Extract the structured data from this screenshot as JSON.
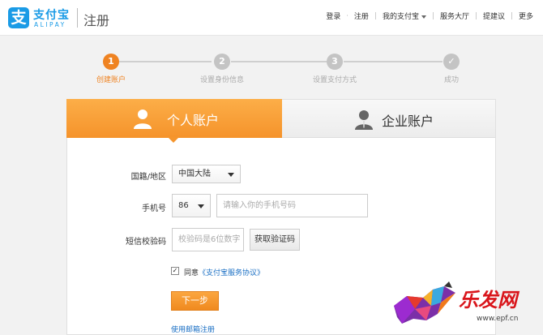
{
  "header": {
    "logo_mark": "支",
    "logo_cn": "支付宝",
    "logo_en": "ALIPAY",
    "page_title": "注册",
    "nav": {
      "login": "登录",
      "register": "注册",
      "my_alipay": "我的支付宝",
      "service_hall": "服务大厅",
      "feedback": "提建议",
      "more": "更多"
    }
  },
  "steps": [
    {
      "num": "1",
      "label": "创建账户"
    },
    {
      "num": "2",
      "label": "设置身份信息"
    },
    {
      "num": "3",
      "label": "设置支付方式"
    },
    {
      "num": "✓",
      "label": "成功"
    }
  ],
  "tabs": {
    "personal": "个人账户",
    "business": "企业账户"
  },
  "form": {
    "region_label": "国籍/地区",
    "region_value": "中国大陆",
    "phone_label": "手机号",
    "phone_code": "86",
    "phone_placeholder": "请输入你的手机号码",
    "sms_label": "短信校验码",
    "sms_placeholder": "校验码是6位数字",
    "get_code": "获取验证码",
    "agree_text": "同意",
    "agreement_link": "《支付宝服务协议》",
    "next": "下一步",
    "email_register": "使用邮箱注册"
  },
  "watermark": {
    "text": "乐发网",
    "url": "www.epf.cn"
  },
  "colors": {
    "brand_blue": "#1a9be6",
    "accent_orange": "#f5932b",
    "link_blue": "#1a6fc4"
  }
}
